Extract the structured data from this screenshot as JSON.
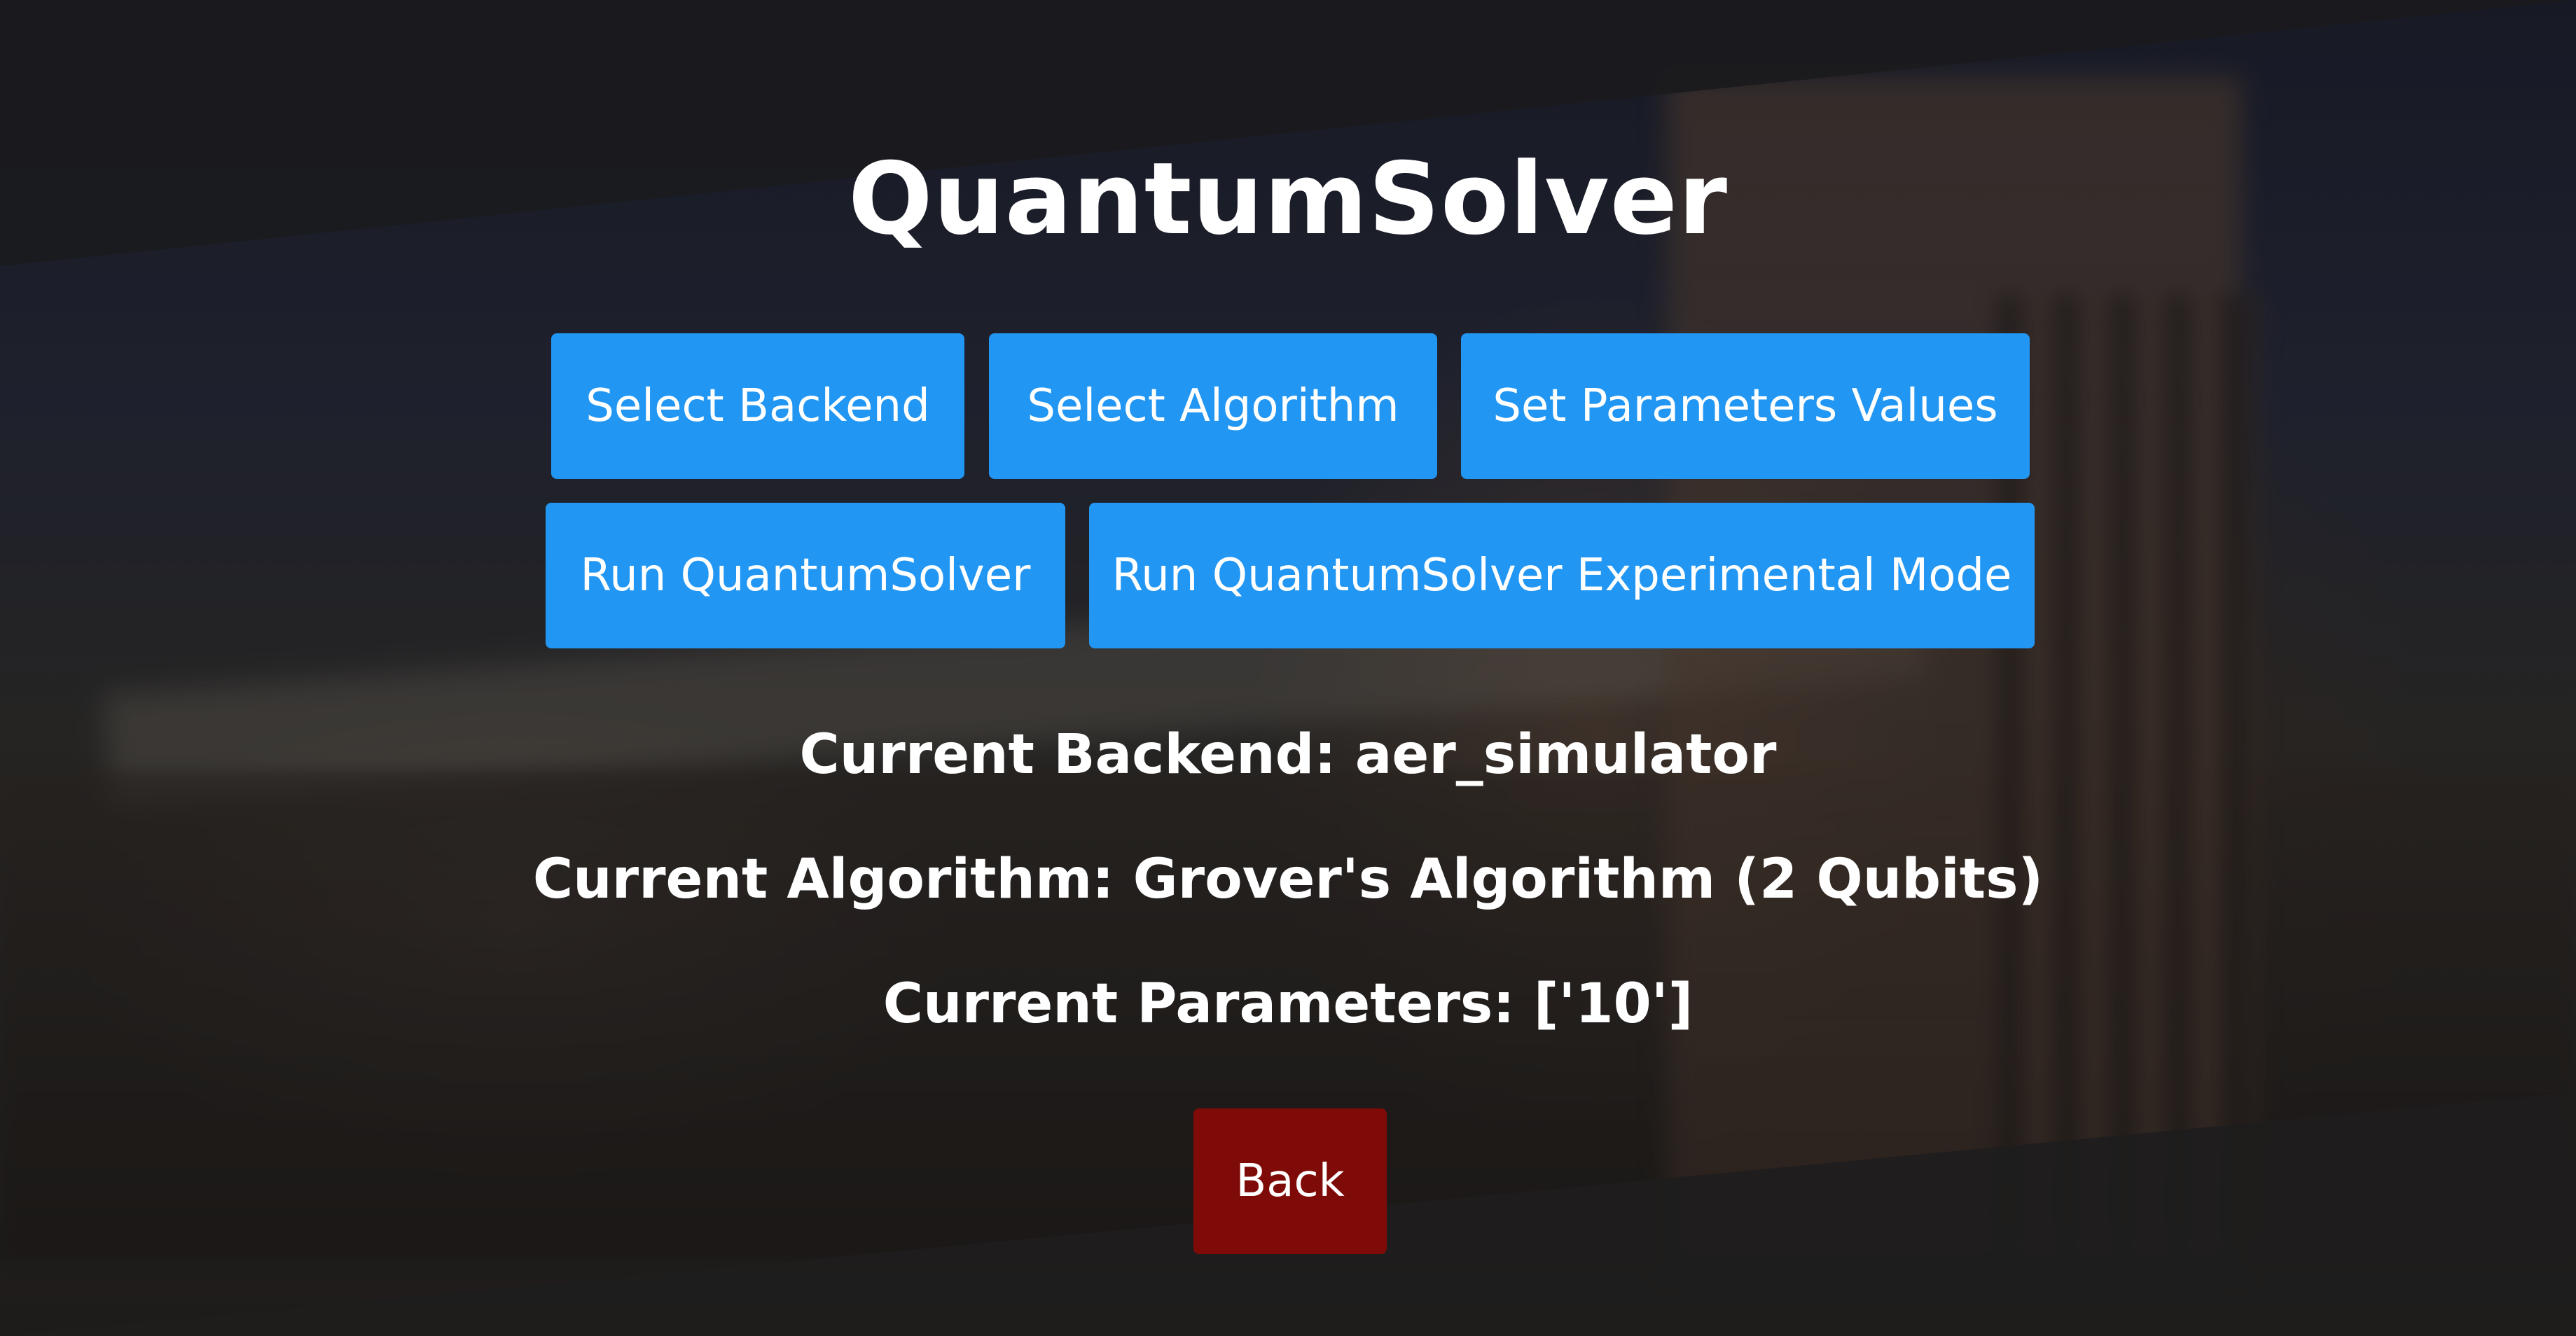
{
  "app": {
    "title": "QuantumSolver"
  },
  "buttons": {
    "select_backend": "Select Backend",
    "select_algorithm": "Select Algorithm",
    "set_parameters": "Set Parameters Values",
    "run": "Run QuantumSolver",
    "run_experimental": "Run QuantumSolver Experimental Mode",
    "back": "Back"
  },
  "status": {
    "backend": "Current Backend: aer_simulator",
    "algorithm": "Current Algorithm: Grover's Algorithm (2 Qubits)",
    "parameters": "Current Parameters: ['10']"
  },
  "colors": {
    "primary_button": "#2196f3",
    "back_button": "#7f0b08",
    "text": "#ffffff"
  }
}
